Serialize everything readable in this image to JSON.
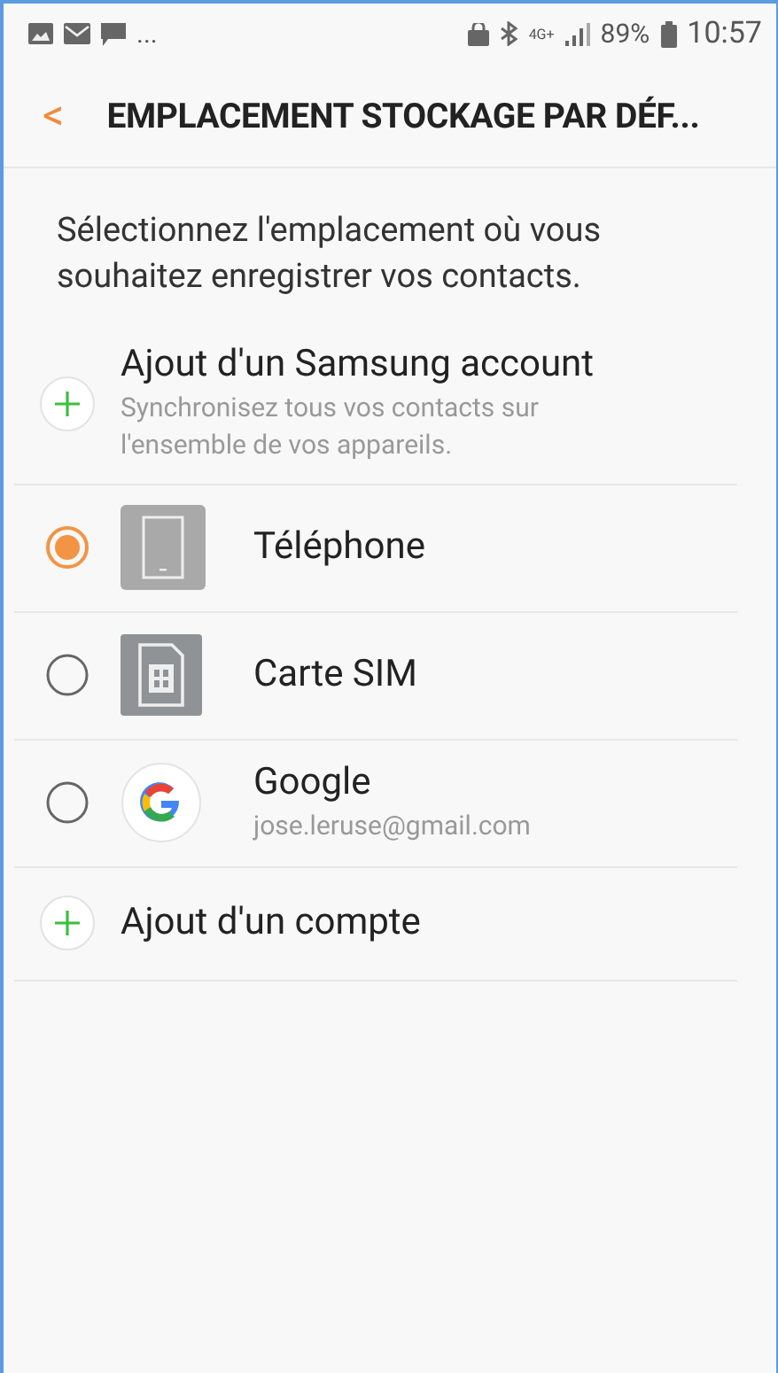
{
  "status_bar": {
    "notifications": "...",
    "battery": "89%",
    "time": "10:57",
    "network": "4G+"
  },
  "header": {
    "back": "<",
    "title": "EMPLACEMENT STOCKAGE PAR DÉF..."
  },
  "description": "Sélectionnez l'emplacement où vous souhaitez enregistrer vos contacts.",
  "options": [
    {
      "kind": "add",
      "label": "Ajout d'un Samsung account",
      "subtitle": "Synchronisez tous vos contacts sur l'ensemble de vos appareils."
    },
    {
      "kind": "phone",
      "label": "Téléphone",
      "selected": true
    },
    {
      "kind": "sim",
      "label": "Carte SIM",
      "selected": false
    },
    {
      "kind": "google",
      "label": "Google",
      "subtitle": "jose.leruse@gmail.com",
      "selected": false
    },
    {
      "kind": "add",
      "label": "Ajout d'un compte"
    }
  ]
}
